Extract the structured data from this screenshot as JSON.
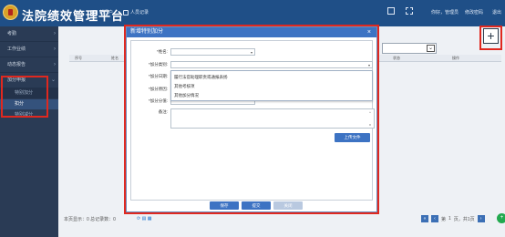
{
  "header": {
    "app_title": "法院绩效管理平台",
    "nav": [
      {
        "label": "新门户"
      },
      {
        "label": "人员记录"
      }
    ],
    "user_info": "你好，管理员",
    "links": [
      "修改密码",
      "退出"
    ]
  },
  "sidebar": {
    "items": [
      {
        "label": "考勤",
        "expanded": false
      },
      {
        "label": "工作业绩",
        "expanded": false
      },
      {
        "label": "动态报告",
        "expanded": false
      },
      {
        "label": "加分申报",
        "expanded": true
      }
    ],
    "subitems": [
      {
        "label": "特别加分",
        "active": false
      },
      {
        "label": "扣分",
        "active": true
      },
      {
        "label": "特别减分",
        "active": false
      }
    ]
  },
  "table": {
    "headers": [
      "序号",
      "姓名",
      "状态",
      "操作"
    ]
  },
  "footer": {
    "record_text": "本页显示：0 总记录数：0",
    "pager": {
      "page_label": "第",
      "page_value": "1",
      "page_total": "页，共1页"
    }
  },
  "modal": {
    "title": "新增特别加分",
    "close": "×",
    "fields": [
      {
        "label": "*姓名:",
        "value": ""
      },
      {
        "label": "*加分类别:",
        "value": ""
      },
      {
        "label": "*加分日期:",
        "value": ""
      },
      {
        "label": "*加分原因:",
        "value": ""
      },
      {
        "label": "*加分分值:",
        "value": ""
      },
      {
        "label": "备注:",
        "value": ""
      }
    ],
    "dropdown_options": [
      "履行法官助理职责或通报表扬",
      "其他考核项",
      "其他加分情况"
    ],
    "upload_label": "上传文件",
    "buttons": {
      "save": "保存",
      "submit": "提交",
      "close": "关闭"
    }
  },
  "colors": {
    "topbar": "#1f4f87",
    "sidebar": "#2a3b55",
    "modal_header": "#3d73c3",
    "highlight": "#e0281f"
  }
}
